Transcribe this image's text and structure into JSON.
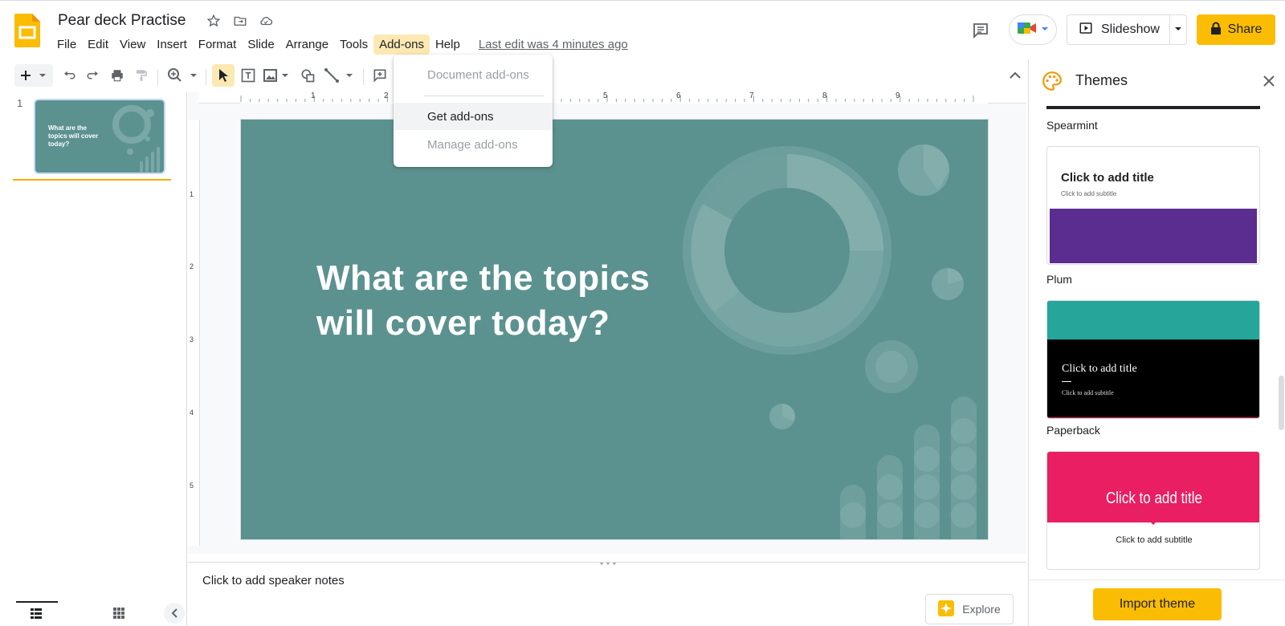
{
  "app": {
    "doc_title": "Pear deck Practise",
    "menus": [
      "File",
      "Edit",
      "View",
      "Insert",
      "Format",
      "Slide",
      "Arrange",
      "Tools",
      "Add-ons",
      "Help"
    ],
    "active_menu": "Add-ons",
    "last_edit": "Last edit was 4 minutes ago",
    "slideshow_label": "Slideshow",
    "share_label": "Share"
  },
  "addons_menu": {
    "items": [
      {
        "label": "Document add-ons",
        "disabled": true
      },
      {
        "label": "Get add-ons",
        "disabled": false,
        "highlighted": true
      },
      {
        "label": "Manage add-ons",
        "disabled": true
      }
    ]
  },
  "ruler": {
    "labels": [
      "1",
      "2",
      "3",
      "4",
      "5",
      "6",
      "7",
      "8",
      "9"
    ],
    "vlabels": [
      "1",
      "2",
      "3",
      "4",
      "5"
    ]
  },
  "filmstrip": {
    "slide_number": "1",
    "thumb_text": "What are the topics will cover today?"
  },
  "slide": {
    "title": "What are the topics will cover today?",
    "background": "#5b9290"
  },
  "notes": {
    "placeholder": "Click to add speaker notes"
  },
  "explore": {
    "label": "Explore"
  },
  "themes_panel": {
    "title": "Themes",
    "themes": [
      {
        "name": "Spearmint",
        "title": "Click to add title",
        "subtitle": "Click to add subtitle",
        "accent": "#5c2d91"
      },
      {
        "name": "Plum",
        "title": "Click to add title",
        "subtitle": "Click to add subtitle",
        "accent": "#26a69a"
      },
      {
        "name": "Paperback",
        "title": "Click to add title",
        "subtitle": "Click to add subtitle",
        "accent": "#e91e63"
      }
    ],
    "import_label": "Import theme"
  },
  "colors": {
    "brand_yellow": "#fbbc04",
    "slide_teal": "#5b9290"
  }
}
